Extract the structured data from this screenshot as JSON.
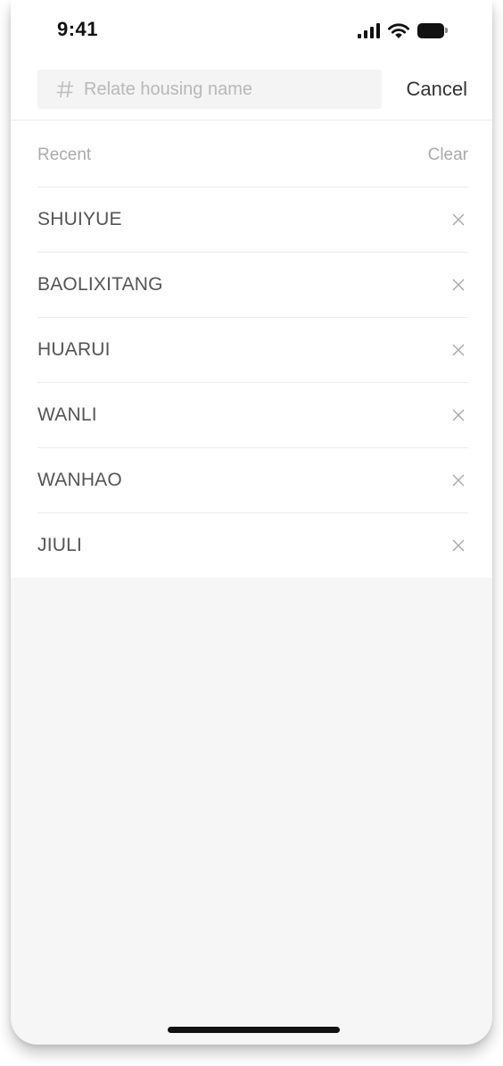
{
  "status_bar": {
    "time": "9:41",
    "icons": [
      "cellular-signal-icon",
      "wifi-icon",
      "battery-icon"
    ]
  },
  "search": {
    "icon": "hash-icon",
    "placeholder": "Relate housing name",
    "value": "",
    "cancel_label": "Cancel"
  },
  "recent": {
    "label": "Recent",
    "clear_label": "Clear",
    "remove_icon": "close-icon",
    "items": [
      {
        "name": "SHUIYUE"
      },
      {
        "name": "BAOLIXITANG"
      },
      {
        "name": "HUARUI"
      },
      {
        "name": "WANLI"
      },
      {
        "name": "WANHAO"
      },
      {
        "name": "JIULI"
      }
    ]
  },
  "colors": {
    "text_primary": "#333333",
    "text_item": "#555555",
    "text_muted": "#aaaaaa",
    "placeholder": "#b8b8b8",
    "search_bg": "#f4f4f4",
    "page_bg": "#f6f6f6",
    "divider": "#ececec"
  }
}
